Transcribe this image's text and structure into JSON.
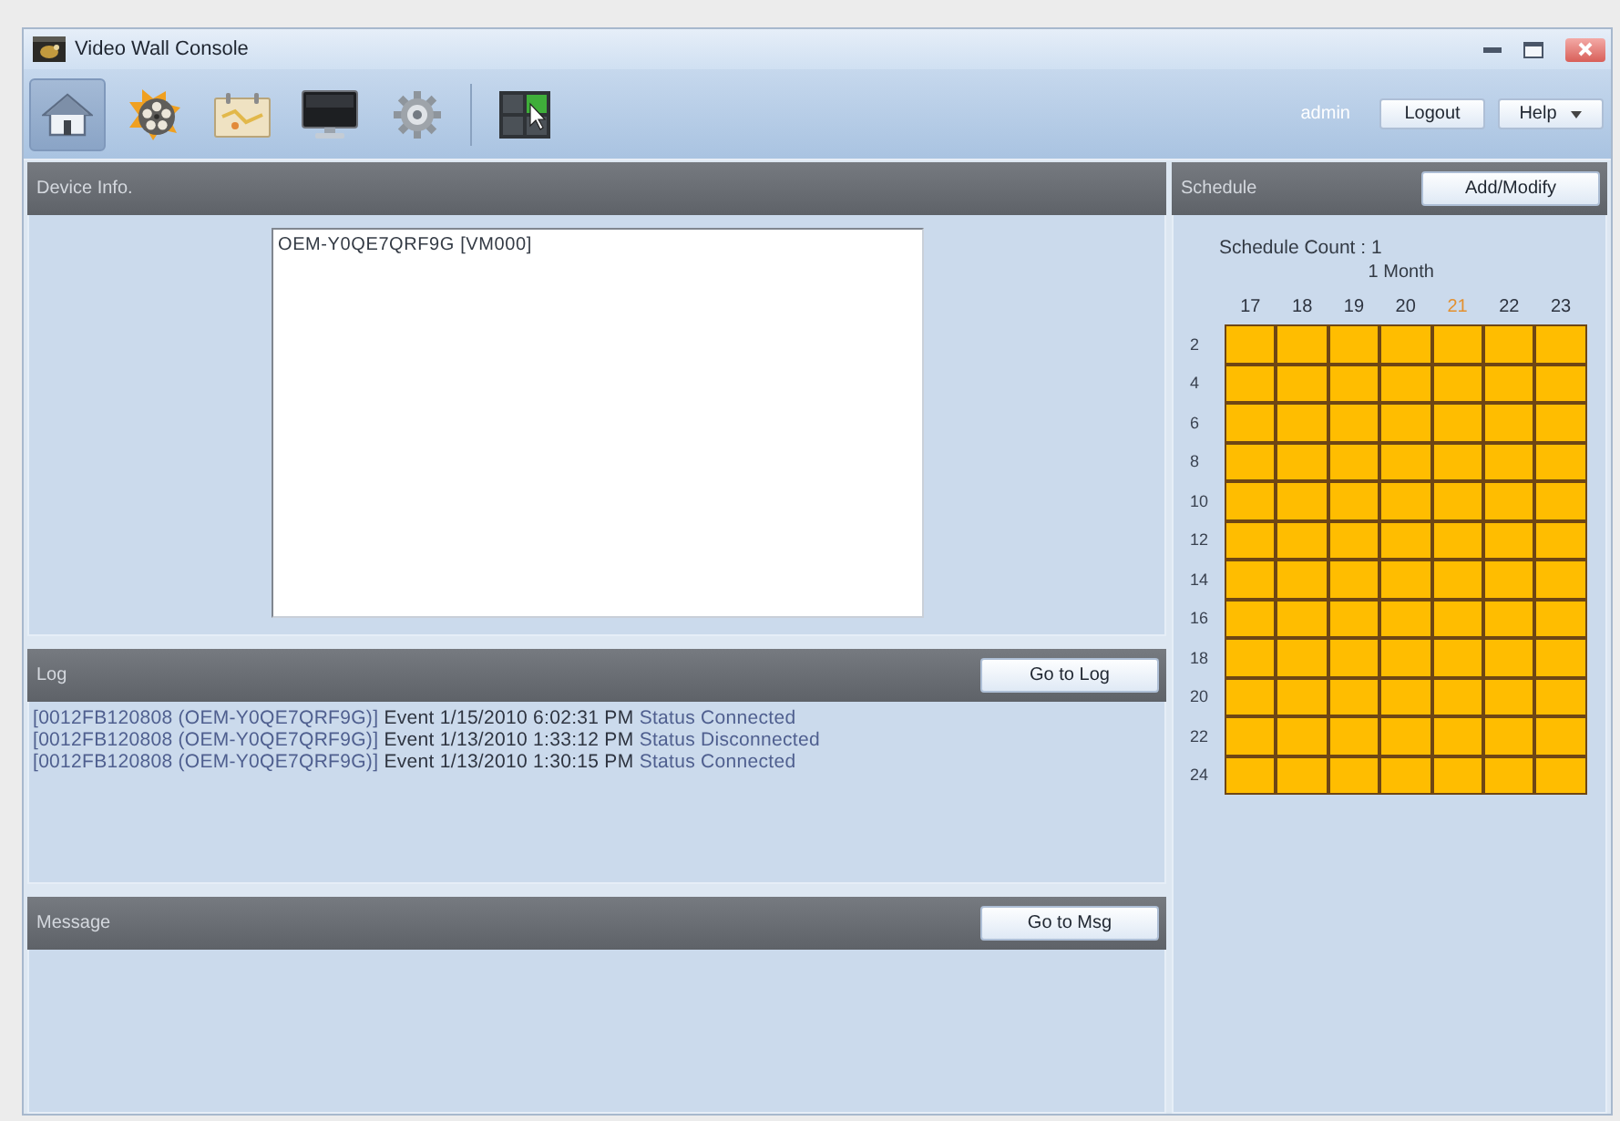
{
  "window": {
    "title": "Video Wall Console"
  },
  "toolbar": {
    "groups": [
      {
        "tools": [
          {
            "kind": "home",
            "selected": true
          },
          {
            "kind": "reel",
            "selected": false
          },
          {
            "kind": "calendar",
            "selected": false
          },
          {
            "kind": "monitor",
            "selected": false
          },
          {
            "kind": "gear",
            "selected": false
          }
        ]
      },
      {
        "tools": [
          {
            "kind": "wall",
            "selected": false
          }
        ]
      }
    ],
    "user": "admin",
    "buttons": [
      {
        "label": "Logout",
        "kind": "plain"
      },
      {
        "label": "Help",
        "kind": "menu"
      }
    ]
  },
  "device_info": {
    "title": "Device Info.",
    "devices": [
      {
        "name": "OEM-Y0QE7QRF9G [VM000]",
        "selected": false
      }
    ]
  },
  "log": {
    "title": "Log",
    "button": "Go to Log",
    "entries": [
      {
        "source": "[0012FB120808 (OEM-Y0QE7QRF9G)]",
        "event": "Event 1/15/2010 6:02:31 PM",
        "status": "Status Connected"
      },
      {
        "source": "[0012FB120808 (OEM-Y0QE7QRF9G)]",
        "event": "Event 1/13/2010 1:33:12 PM",
        "status": "Status Disconnected"
      },
      {
        "source": "[0012FB120808 (OEM-Y0QE7QRF9G)]",
        "event": "Event 1/13/2010 1:30:15 PM",
        "status": "Status Connected"
      }
    ]
  },
  "message": {
    "title": "Message",
    "button": "Go to Msg"
  },
  "schedule": {
    "title": "Schedule",
    "button": "Add/Modify",
    "count": "Schedule Count : 1",
    "range": "1 Month",
    "days": [
      {
        "label": "17",
        "today": false
      },
      {
        "label": "18",
        "today": false
      },
      {
        "label": "19",
        "today": false
      },
      {
        "label": "20",
        "today": false
      },
      {
        "label": "21",
        "today": true
      },
      {
        "label": "22",
        "today": false
      },
      {
        "label": "23",
        "today": false
      }
    ],
    "rows": [
      {
        "hour": "2",
        "cells": [
          {
            "on": true
          },
          {
            "on": true
          },
          {
            "on": true
          },
          {
            "on": true
          },
          {
            "on": true
          },
          {
            "on": true
          },
          {
            "on": true
          }
        ]
      },
      {
        "hour": "4",
        "cells": [
          {
            "on": true
          },
          {
            "on": true
          },
          {
            "on": true
          },
          {
            "on": true
          },
          {
            "on": true
          },
          {
            "on": true
          },
          {
            "on": true
          }
        ]
      },
      {
        "hour": "6",
        "cells": [
          {
            "on": true
          },
          {
            "on": true
          },
          {
            "on": true
          },
          {
            "on": true
          },
          {
            "on": true
          },
          {
            "on": true
          },
          {
            "on": true
          }
        ]
      },
      {
        "hour": "8",
        "cells": [
          {
            "on": true
          },
          {
            "on": true
          },
          {
            "on": true
          },
          {
            "on": true
          },
          {
            "on": true
          },
          {
            "on": true
          },
          {
            "on": true
          }
        ]
      },
      {
        "hour": "10",
        "cells": [
          {
            "on": true
          },
          {
            "on": true
          },
          {
            "on": true
          },
          {
            "on": true
          },
          {
            "on": true
          },
          {
            "on": true
          },
          {
            "on": true
          }
        ]
      },
      {
        "hour": "12",
        "cells": [
          {
            "on": true
          },
          {
            "on": true
          },
          {
            "on": true
          },
          {
            "on": true
          },
          {
            "on": true
          },
          {
            "on": true
          },
          {
            "on": true
          }
        ]
      },
      {
        "hour": "14",
        "cells": [
          {
            "on": true
          },
          {
            "on": true
          },
          {
            "on": true
          },
          {
            "on": true
          },
          {
            "on": true
          },
          {
            "on": true
          },
          {
            "on": true
          }
        ]
      },
      {
        "hour": "16",
        "cells": [
          {
            "on": true
          },
          {
            "on": true
          },
          {
            "on": true
          },
          {
            "on": true
          },
          {
            "on": true
          },
          {
            "on": true
          },
          {
            "on": true
          }
        ]
      },
      {
        "hour": "18",
        "cells": [
          {
            "on": true
          },
          {
            "on": true
          },
          {
            "on": true
          },
          {
            "on": true
          },
          {
            "on": true
          },
          {
            "on": true
          },
          {
            "on": true
          }
        ]
      },
      {
        "hour": "20",
        "cells": [
          {
            "on": true
          },
          {
            "on": true
          },
          {
            "on": true
          },
          {
            "on": true
          },
          {
            "on": true
          },
          {
            "on": true
          },
          {
            "on": true
          }
        ]
      },
      {
        "hour": "22",
        "cells": [
          {
            "on": true
          },
          {
            "on": true
          },
          {
            "on": true
          },
          {
            "on": true
          },
          {
            "on": true
          },
          {
            "on": true
          },
          {
            "on": true
          }
        ]
      },
      {
        "hour": "24",
        "cells": [
          {
            "on": true
          },
          {
            "on": true
          },
          {
            "on": true
          },
          {
            "on": true
          },
          {
            "on": true
          },
          {
            "on": true
          },
          {
            "on": true
          }
        ]
      }
    ]
  }
}
